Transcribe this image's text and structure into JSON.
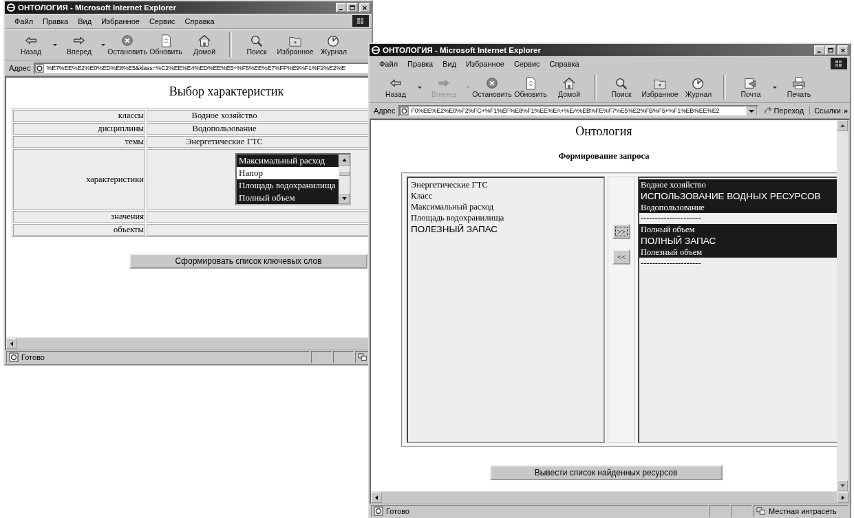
{
  "windows": [
    {
      "title": "ОНТОЛОГИЯ - Microsoft Internet Explorer",
      "menu": [
        "Файл",
        "Правка",
        "Вид",
        "Избранное",
        "Сервис",
        "Справка"
      ],
      "toolbar": [
        [
          {
            "kind": "back",
            "label": "Назад",
            "disabled": false,
            "dropdown": true
          },
          {
            "kind": "forward",
            "label": "Вперед",
            "disabled": false,
            "dropdown": true
          },
          {
            "kind": "stop",
            "label": "Остановить",
            "disabled": false,
            "dropdown": false
          },
          {
            "kind": "refresh",
            "label": "Обновить",
            "disabled": false,
            "dropdown": false
          },
          {
            "kind": "home",
            "label": "Домой",
            "disabled": false,
            "dropdown": false
          }
        ],
        [
          {
            "kind": "search",
            "label": "Поиск",
            "disabled": false,
            "dropdown": false
          },
          {
            "kind": "favorites",
            "label": "Избранное",
            "disabled": false,
            "dropdown": false
          },
          {
            "kind": "history",
            "label": "Журнал",
            "disabled": false,
            "dropdown": false
          }
        ]
      ],
      "address_label": "Адрес",
      "address": "%E7%EE%E2%E0%ED%E8%E5&klass=%C2%EE%E4%ED%EE%E5+%F5%EE%E7%FF%E9%F1%F2%E2%E",
      "page": {
        "kind": "form",
        "heading": "Выбор характеристик",
        "rows": [
          {
            "label": "классы",
            "kind": "text",
            "value": "Водное хозяйство"
          },
          {
            "label": "дисциплины",
            "kind": "text",
            "value": "Водопользование"
          },
          {
            "label": "темы",
            "kind": "text",
            "value": "Энергетические ГТС"
          },
          {
            "label": "характеристики",
            "kind": "list",
            "options": [
              {
                "text": "Максимальный расход",
                "selected": true
              },
              {
                "text": "Напор",
                "selected": false
              },
              {
                "text": "Площадь водохранилища",
                "selected": true
              },
              {
                "text": "Полный объем",
                "selected": true
              }
            ]
          },
          {
            "label": "значения",
            "kind": "text"
          },
          {
            "label": "объекты",
            "kind": "text"
          }
        ],
        "button": "Сформировать список ключевых слов"
      },
      "status": "Готово"
    },
    {
      "title": "ОНТОЛОГИЯ - Microsoft Internet Explorer",
      "menu": [
        "Файл",
        "Правка",
        "Вид",
        "Избранное",
        "Сервис",
        "Справка"
      ],
      "toolbar": [
        [
          {
            "kind": "back",
            "label": "Назад",
            "disabled": false,
            "dropdown": true
          },
          {
            "kind": "forward",
            "label": "Вперед",
            "disabled": true,
            "dropdown": true
          },
          {
            "kind": "stop",
            "label": "Остановить",
            "disabled": false,
            "dropdown": false
          },
          {
            "kind": "refresh",
            "label": "Обновить",
            "disabled": false,
            "dropdown": false
          },
          {
            "kind": "home",
            "label": "Домой",
            "disabled": false,
            "dropdown": false
          }
        ],
        [
          {
            "kind": "search",
            "label": "Поиск",
            "disabled": false,
            "dropdown": false
          },
          {
            "kind": "favorites",
            "label": "Избранное",
            "disabled": false,
            "dropdown": false
          },
          {
            "kind": "history",
            "label": "Журнал",
            "disabled": false,
            "dropdown": false
          }
        ],
        [
          {
            "kind": "mail",
            "label": "Почта",
            "disabled": false,
            "dropdown": true
          },
          {
            "kind": "print",
            "label": "Печать",
            "disabled": false,
            "dropdown": false
          }
        ]
      ],
      "address_label": "Адрес",
      "address": "F0%EE%E2%E0%F2%FC+%F1%EF%E8%F1%EE%EA+%EA%EB%FE%F7%E5%E2%FB%F5+%F1%EB%EE%E2",
      "go": "Переход",
      "links": "Ссылки",
      "links_more": "»",
      "page": {
        "kind": "query",
        "heading": "Онтология",
        "subheading": "Формирование запроса",
        "source": [
          {
            "text": "Энергетические ГТС",
            "kind": "term"
          },
          {
            "text": "Класс",
            "kind": "term"
          },
          {
            "text": "Максимальный расход",
            "kind": "term"
          },
          {
            "text": "Площадь водохранилища",
            "kind": "term"
          },
          {
            "text": "ПОЛЕЗНЫЙ ЗАПАС",
            "kind": "concept"
          }
        ],
        "add": ">>",
        "remove": "<<",
        "target": [
          {
            "text": "Водное хозяйство",
            "kind": "term",
            "selected": true
          },
          {
            "text": "ИСПОЛЬЗОВАНИЕ ВОДНЫХ РЕСУРСОВ",
            "kind": "concept",
            "selected": true
          },
          {
            "text": "Водопользование",
            "kind": "term",
            "selected": true
          },
          {
            "text": "---------------------",
            "kind": "term",
            "selected": false
          },
          {
            "text": "Полный объем",
            "kind": "term",
            "selected": true
          },
          {
            "text": "ПОЛНЫЙ ЗАПАС",
            "kind": "concept",
            "selected": true
          },
          {
            "text": "Полезный объем",
            "kind": "term",
            "selected": true
          },
          {
            "text": "---------------------",
            "kind": "term",
            "selected": false
          }
        ],
        "button": "Вывести список найденных ресурсов"
      },
      "status": "Готово",
      "zone": "Местная интрасеть"
    }
  ]
}
